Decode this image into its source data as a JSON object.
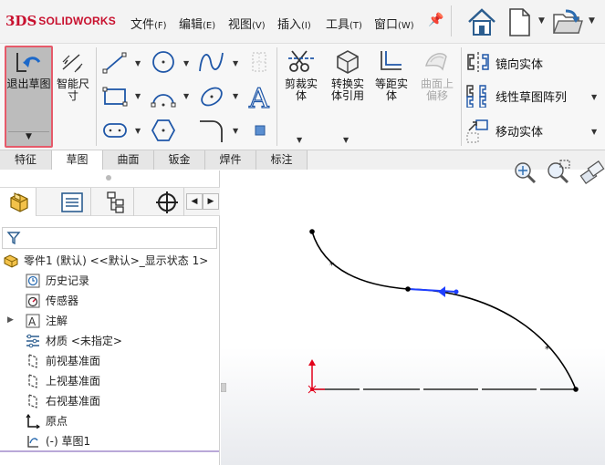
{
  "app": {
    "logo_mark": "3DS",
    "logo_text": "SOLIDWORKS"
  },
  "menu": [
    {
      "label": "文件",
      "accel": "(F)"
    },
    {
      "label": "编辑",
      "accel": "(E)"
    },
    {
      "label": "视图",
      "accel": "(V)"
    },
    {
      "label": "插入",
      "accel": "(I)"
    },
    {
      "label": "工具",
      "accel": "(T)"
    },
    {
      "label": "窗口",
      "accel": "(W)"
    }
  ],
  "quick_access": {
    "icons": [
      "home-icon",
      "new-document-icon",
      "open-icon"
    ]
  },
  "commands": {
    "exit_sketch": "退出草图",
    "smart_dimension": "智能尺寸",
    "trim_entities": "剪裁实体",
    "convert_entities": "转换实体引用",
    "offset_entities": "等距实体",
    "offset_on_surface": "曲面上偏移",
    "mirror_entities": "镜向实体",
    "linear_pattern": "线性草图阵列",
    "move_entities": "移动实体"
  },
  "tabs": [
    {
      "label": "特征",
      "active": false
    },
    {
      "label": "草图",
      "active": true
    },
    {
      "label": "曲面",
      "active": false
    },
    {
      "label": "钣金",
      "active": false
    },
    {
      "label": "焊件",
      "active": false
    },
    {
      "label": "标注",
      "active": false
    }
  ],
  "feature_tree": {
    "part": "零件1 (默认) <<默认>_显示状态 1>",
    "items": [
      {
        "label": "历史记录",
        "icon": "history-icon",
        "expandable": false
      },
      {
        "label": "传感器",
        "icon": "sensor-icon",
        "expandable": false
      },
      {
        "label": "注解",
        "icon": "annotation-icon",
        "expandable": true
      },
      {
        "label": "材质 <未指定>",
        "icon": "material-icon",
        "expandable": false
      },
      {
        "label": "前视基准面",
        "icon": "plane-icon",
        "expandable": false
      },
      {
        "label": "上视基准面",
        "icon": "plane-icon",
        "expandable": false
      },
      {
        "label": "右视基准面",
        "icon": "plane-icon",
        "expandable": false
      },
      {
        "label": "原点",
        "icon": "origin-icon",
        "expandable": false
      },
      {
        "label": "(-) 草图1",
        "icon": "sketch-icon",
        "expandable": false
      }
    ]
  },
  "colors": {
    "sketch_line": "#000000",
    "selection_blue": "#1f3fff",
    "origin_red": "#e3001b",
    "exit_border": "#e65a6a",
    "logo_red": "#c8102e"
  }
}
